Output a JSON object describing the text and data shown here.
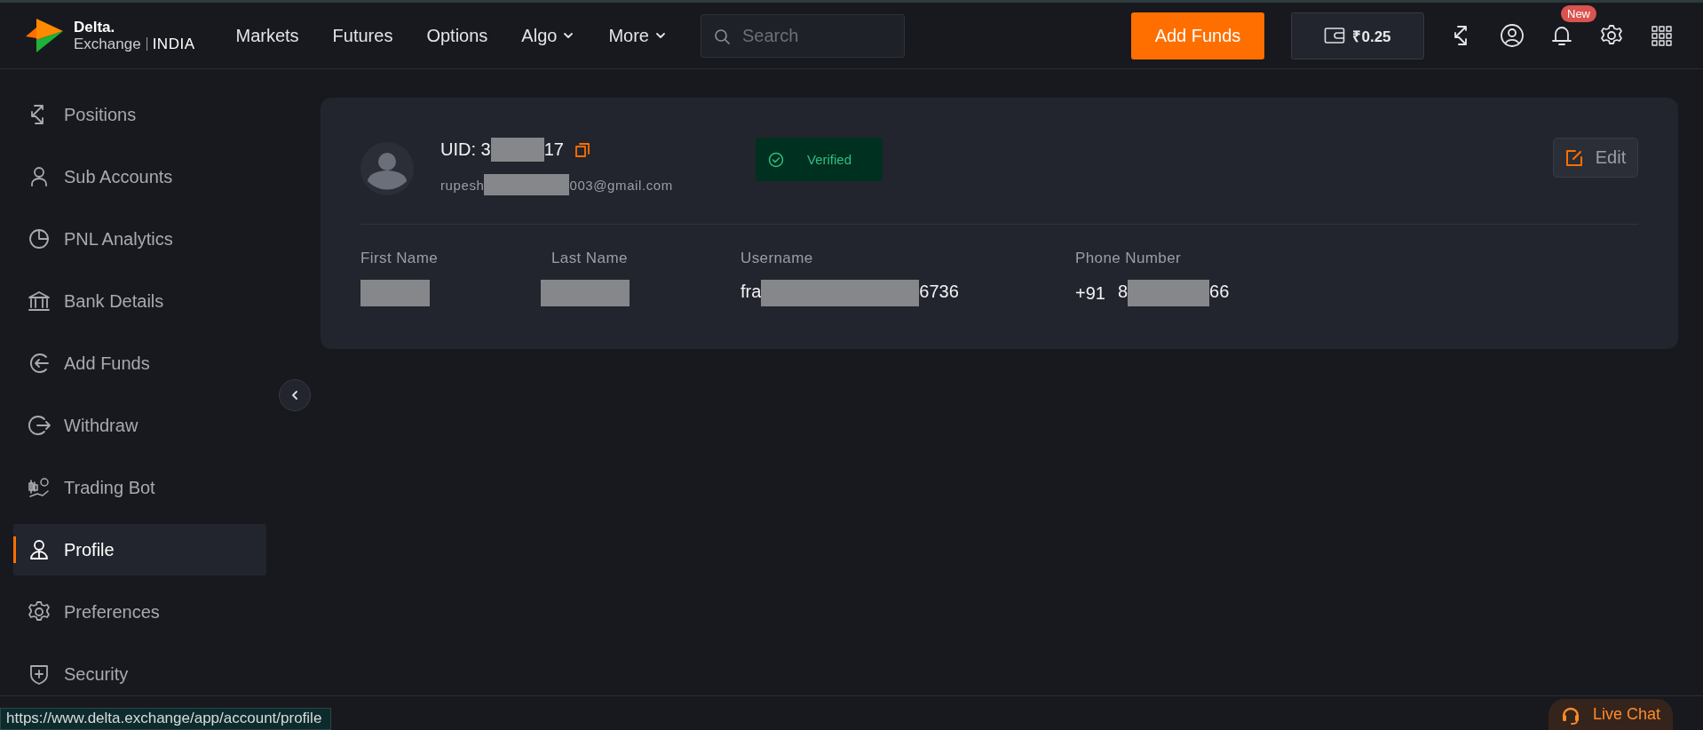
{
  "brand": {
    "name": "Delta.",
    "line2": "Exchange",
    "region": "INDIA"
  },
  "nav": [
    {
      "label": "Markets",
      "dropdown": false
    },
    {
      "label": "Futures",
      "dropdown": false
    },
    {
      "label": "Options",
      "dropdown": false
    },
    {
      "label": "Algo",
      "dropdown": true
    },
    {
      "label": "More",
      "dropdown": true
    }
  ],
  "search": {
    "placeholder": "Search"
  },
  "add_funds_button": "Add Funds",
  "wallet": {
    "balance": "₹0.25"
  },
  "notification_badge": "New",
  "sidebar": {
    "items": [
      {
        "label": "Positions",
        "selected": false
      },
      {
        "label": "Sub Accounts",
        "selected": false
      },
      {
        "label": "PNL Analytics",
        "selected": false
      },
      {
        "label": "Bank Details",
        "selected": false
      },
      {
        "label": "Add Funds",
        "selected": false
      },
      {
        "label": "Withdraw",
        "selected": false
      },
      {
        "label": "Trading Bot",
        "selected": false
      },
      {
        "label": "Profile",
        "selected": true
      },
      {
        "label": "Preferences",
        "selected": false
      },
      {
        "label": "Security",
        "selected": false
      }
    ]
  },
  "profile": {
    "uid": {
      "before": "UID: 3",
      "redacted": true,
      "after": "17"
    },
    "email": {
      "before": "rupesh",
      "redacted": true,
      "after": "003@gmail.com"
    },
    "status": {
      "label": "Verified",
      "verified": true
    },
    "edit_button": "Edit",
    "fields": [
      {
        "label": "First Name",
        "value": {
          "redacted": true
        }
      },
      {
        "label": "Last Name",
        "value": {
          "redacted": true
        }
      },
      {
        "label": "Username",
        "value": {
          "before": "fra",
          "redacted": true,
          "after": "6736"
        }
      },
      {
        "label": "Phone Number",
        "country_code": "+91",
        "value": {
          "before": "8",
          "redacted": true,
          "after": "66"
        }
      }
    ]
  },
  "status_bar": {
    "url": "https://www.delta.exchange/app/account/profile"
  },
  "live_chat": "Live Chat"
}
